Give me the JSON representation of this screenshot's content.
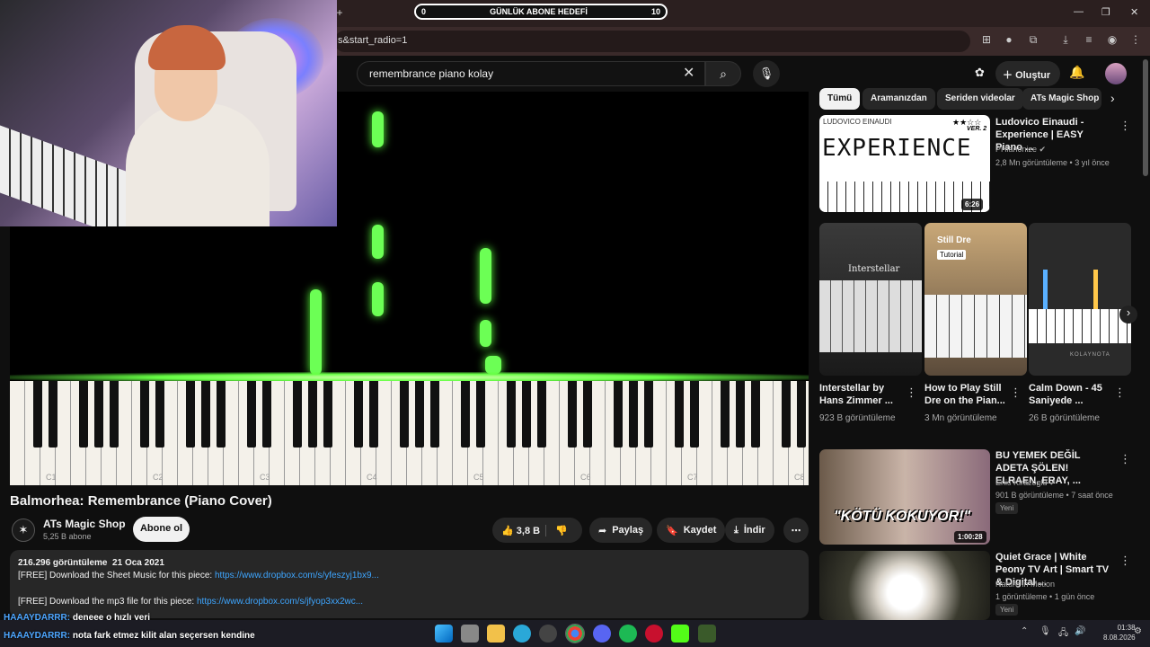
{
  "browser": {
    "url": "s&start_radio=1",
    "subscriber_goal": {
      "label": "GÜNLÜK ABONE HEDEFİ",
      "current": "0",
      "target": "10"
    }
  },
  "header": {
    "search_value": "remembrance piano kolay",
    "create_label": "Oluştur"
  },
  "video": {
    "octave_labels": [
      "C1",
      "C2",
      "C3",
      "C4",
      "C5",
      "C6",
      "C7",
      "C8"
    ],
    "title": "Balmorhea: Remembrance (Piano Cover)",
    "channel": "ATs Magic Shop",
    "subscribers": "5,25 B abone",
    "subscribe_label": "Abone ol",
    "likes": "3,8 B",
    "share_label": "Paylaş",
    "save_label": "Kaydet",
    "download_label": "İndir",
    "views": "216.296 görüntüleme",
    "date": "21 Oca 2021",
    "desc_line1_text": "[FREE] Download the Sheet Music for this piece:",
    "desc_line1_link": "https://www.dropbox.com/s/yfeszyj1bx9...",
    "desc_line2_text": "[FREE] Download the mp3 file for this piece:",
    "desc_line2_link": "https://www.dropbox.com/s/jfyop3xx2wc..."
  },
  "chips": [
    "Tümü",
    "Aramanızdan",
    "Seriden videolar",
    "ATs Magic Shop"
  ],
  "sidebar": {
    "v1": {
      "title": "Ludovico Einaudi - Experience | EASY Piano ...",
      "channel": "PHianonize",
      "meta": "2,8 Mn görüntüleme • 3 yıl önce",
      "duration": "6:26",
      "thumb_top": "LUDOVICO EINAUDI",
      "thumb_title": "EXPERIENCE",
      "thumb_tag": "VER. 2"
    },
    "shorts": [
      {
        "title": "Interstellar by Hans Zimmer ...",
        "views": "923 B görüntüleme",
        "thumb_label": "Interstellar"
      },
      {
        "title": "How to Play Still Dre on the Pian...",
        "views": "3 Mn görüntüleme",
        "thumb_label": "Still Dre",
        "thumb_tag": "Tutorial"
      },
      {
        "title": "Calm Down - 45 Saniyede ...",
        "views": "26 B görüntüleme",
        "thumb_label": "KOLAYNOTA"
      }
    ],
    "v2": {
      "title": "BU YEMEK DEĞİL ADETA ŞÖLEN! ELRAEN, ERAY, ...",
      "channel": "Enis Kirazoglu",
      "meta": "901 B görüntüleme • 7 saat önce",
      "badge": "Yeni",
      "duration": "1:00:28",
      "thumb_caption": "\"KÖTÜ KOKUYOR!\""
    },
    "v3": {
      "title": "Quiet Grace | White Peony TV Art | Smart TV & Digital ...",
      "channel": "Nature in Motion",
      "meta": "1 görüntüleme • 1 gün önce",
      "badge": "Yeni"
    }
  },
  "chat": [
    {
      "user": "HAAAYDARRR:",
      "msg": "deneee o hızlı yeri"
    },
    {
      "user": "HAAAYDARRR:",
      "msg": "nota fark etmez kilit alan seçersen kendine"
    }
  ],
  "taskbar": {
    "time": "01:38",
    "date": "8.08.2026"
  }
}
